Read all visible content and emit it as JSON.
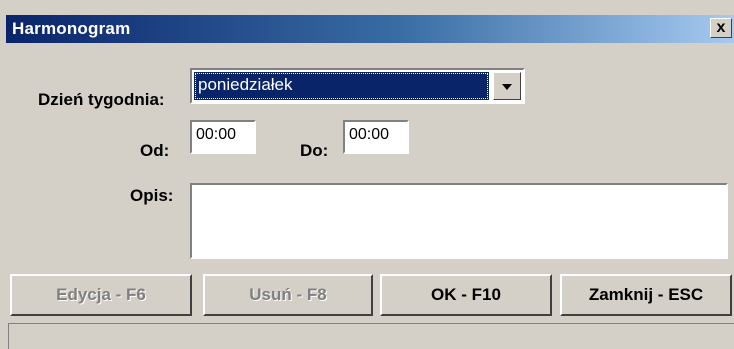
{
  "window": {
    "title": "Harmonogram",
    "close_glyph": "x"
  },
  "form": {
    "day_label": "Dzień tygodnia:",
    "day_value": "poniedziałek",
    "from_label": "Od:",
    "from_value": "00:00",
    "to_label": "Do:",
    "to_value": "00:00",
    "description_label": "Opis:",
    "description_value": ""
  },
  "buttons": {
    "edit": "Edycja - F6",
    "delete": "Usuń - F8",
    "ok": "OK - F10",
    "close": "Zamknij - ESC"
  },
  "colors": {
    "title_bar": "#0a246a",
    "face": "#d4d0c8",
    "selection": "#0a246a"
  }
}
